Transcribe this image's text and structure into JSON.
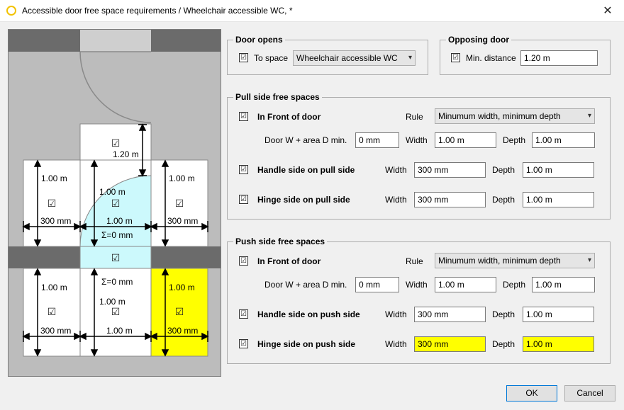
{
  "window": {
    "title": "Accessible door free space requirements / Wheelchair accessible WC, *",
    "close_glyph": "✕"
  },
  "diagram": {
    "labels": {
      "dim_1_20": "1.20 m",
      "dim_1_00": "1.00 m",
      "dim_300": "300 mm",
      "sum_zero": "Σ=0 mm"
    },
    "check_glyph": "☑",
    "colors": {
      "wall": "#6b6b6b",
      "floor": "#bcbcbc",
      "zone": "#ffffff",
      "swing": "#ccf9fc",
      "highlight": "#ffff00"
    }
  },
  "door_opens": {
    "legend": "Door opens",
    "to_space_label": "To space",
    "to_space_checked": true,
    "to_space_value": "Wheelchair accessible WC"
  },
  "opposing_door": {
    "legend": "Opposing door",
    "min_distance_label": "Min. distance",
    "min_distance_checked": true,
    "min_distance_value": "1.20 m"
  },
  "pull_side": {
    "legend": "Pull side free spaces",
    "front": {
      "label": "In Front of door",
      "checked": true,
      "rule_label": "Rule",
      "rule_value": "Minumum width, minimum depth",
      "door_w_label": "Door W + area D min.",
      "door_w_value": "0 mm",
      "width_label": "Width",
      "width_value": "1.00 m",
      "depth_label": "Depth",
      "depth_value": "1.00 m"
    },
    "handle": {
      "label": "Handle side on pull side",
      "checked": true,
      "width_label": "Width",
      "width_value": "300 mm",
      "depth_label": "Depth",
      "depth_value": "1.00 m"
    },
    "hinge": {
      "label": "Hinge side on pull side",
      "checked": true,
      "width_label": "Width",
      "width_value": "300 mm",
      "depth_label": "Depth",
      "depth_value": "1.00 m"
    }
  },
  "push_side": {
    "legend": "Push side free spaces",
    "front": {
      "label": "In Front of door",
      "checked": true,
      "rule_label": "Rule",
      "rule_value": "Minumum width, minimum depth",
      "door_w_label": "Door W + area D min.",
      "door_w_value": "0 mm",
      "width_label": "Width",
      "width_value": "1.00 m",
      "depth_label": "Depth",
      "depth_value": "1.00 m"
    },
    "handle": {
      "label": "Handle side on push side",
      "checked": true,
      "width_label": "Width",
      "width_value": "300 mm",
      "depth_label": "Depth",
      "depth_value": "1.00 m"
    },
    "hinge": {
      "label": "Hinge side on push side",
      "checked": true,
      "width_label": "Width",
      "width_value": "300 mm",
      "depth_label": "Depth",
      "depth_value": "1.00 m"
    }
  },
  "buttons": {
    "ok": "OK",
    "cancel": "Cancel"
  }
}
